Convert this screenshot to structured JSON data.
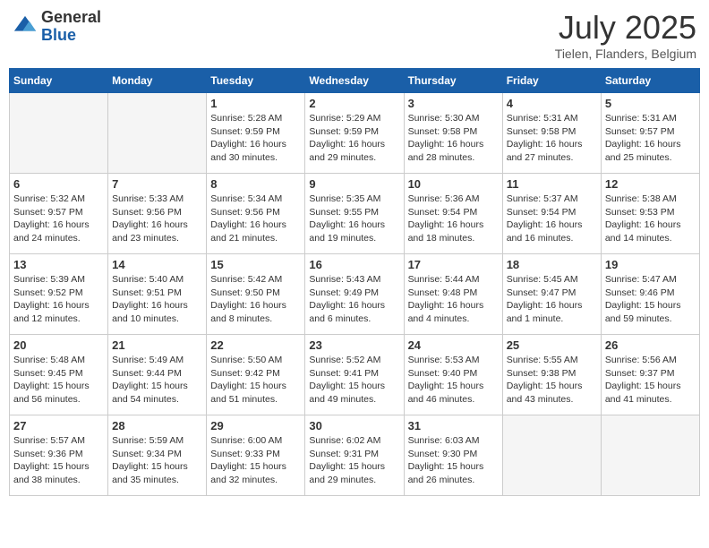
{
  "logo": {
    "general": "General",
    "blue": "Blue"
  },
  "header": {
    "month": "July 2025",
    "location": "Tielen, Flanders, Belgium"
  },
  "weekdays": [
    "Sunday",
    "Monday",
    "Tuesday",
    "Wednesday",
    "Thursday",
    "Friday",
    "Saturday"
  ],
  "weeks": [
    [
      {
        "day": "",
        "info": ""
      },
      {
        "day": "",
        "info": ""
      },
      {
        "day": "1",
        "info": "Sunrise: 5:28 AM\nSunset: 9:59 PM\nDaylight: 16 hours\nand 30 minutes."
      },
      {
        "day": "2",
        "info": "Sunrise: 5:29 AM\nSunset: 9:59 PM\nDaylight: 16 hours\nand 29 minutes."
      },
      {
        "day": "3",
        "info": "Sunrise: 5:30 AM\nSunset: 9:58 PM\nDaylight: 16 hours\nand 28 minutes."
      },
      {
        "day": "4",
        "info": "Sunrise: 5:31 AM\nSunset: 9:58 PM\nDaylight: 16 hours\nand 27 minutes."
      },
      {
        "day": "5",
        "info": "Sunrise: 5:31 AM\nSunset: 9:57 PM\nDaylight: 16 hours\nand 25 minutes."
      }
    ],
    [
      {
        "day": "6",
        "info": "Sunrise: 5:32 AM\nSunset: 9:57 PM\nDaylight: 16 hours\nand 24 minutes."
      },
      {
        "day": "7",
        "info": "Sunrise: 5:33 AM\nSunset: 9:56 PM\nDaylight: 16 hours\nand 23 minutes."
      },
      {
        "day": "8",
        "info": "Sunrise: 5:34 AM\nSunset: 9:56 PM\nDaylight: 16 hours\nand 21 minutes."
      },
      {
        "day": "9",
        "info": "Sunrise: 5:35 AM\nSunset: 9:55 PM\nDaylight: 16 hours\nand 19 minutes."
      },
      {
        "day": "10",
        "info": "Sunrise: 5:36 AM\nSunset: 9:54 PM\nDaylight: 16 hours\nand 18 minutes."
      },
      {
        "day": "11",
        "info": "Sunrise: 5:37 AM\nSunset: 9:54 PM\nDaylight: 16 hours\nand 16 minutes."
      },
      {
        "day": "12",
        "info": "Sunrise: 5:38 AM\nSunset: 9:53 PM\nDaylight: 16 hours\nand 14 minutes."
      }
    ],
    [
      {
        "day": "13",
        "info": "Sunrise: 5:39 AM\nSunset: 9:52 PM\nDaylight: 16 hours\nand 12 minutes."
      },
      {
        "day": "14",
        "info": "Sunrise: 5:40 AM\nSunset: 9:51 PM\nDaylight: 16 hours\nand 10 minutes."
      },
      {
        "day": "15",
        "info": "Sunrise: 5:42 AM\nSunset: 9:50 PM\nDaylight: 16 hours\nand 8 minutes."
      },
      {
        "day": "16",
        "info": "Sunrise: 5:43 AM\nSunset: 9:49 PM\nDaylight: 16 hours\nand 6 minutes."
      },
      {
        "day": "17",
        "info": "Sunrise: 5:44 AM\nSunset: 9:48 PM\nDaylight: 16 hours\nand 4 minutes."
      },
      {
        "day": "18",
        "info": "Sunrise: 5:45 AM\nSunset: 9:47 PM\nDaylight: 16 hours\nand 1 minute."
      },
      {
        "day": "19",
        "info": "Sunrise: 5:47 AM\nSunset: 9:46 PM\nDaylight: 15 hours\nand 59 minutes."
      }
    ],
    [
      {
        "day": "20",
        "info": "Sunrise: 5:48 AM\nSunset: 9:45 PM\nDaylight: 15 hours\nand 56 minutes."
      },
      {
        "day": "21",
        "info": "Sunrise: 5:49 AM\nSunset: 9:44 PM\nDaylight: 15 hours\nand 54 minutes."
      },
      {
        "day": "22",
        "info": "Sunrise: 5:50 AM\nSunset: 9:42 PM\nDaylight: 15 hours\nand 51 minutes."
      },
      {
        "day": "23",
        "info": "Sunrise: 5:52 AM\nSunset: 9:41 PM\nDaylight: 15 hours\nand 49 minutes."
      },
      {
        "day": "24",
        "info": "Sunrise: 5:53 AM\nSunset: 9:40 PM\nDaylight: 15 hours\nand 46 minutes."
      },
      {
        "day": "25",
        "info": "Sunrise: 5:55 AM\nSunset: 9:38 PM\nDaylight: 15 hours\nand 43 minutes."
      },
      {
        "day": "26",
        "info": "Sunrise: 5:56 AM\nSunset: 9:37 PM\nDaylight: 15 hours\nand 41 minutes."
      }
    ],
    [
      {
        "day": "27",
        "info": "Sunrise: 5:57 AM\nSunset: 9:36 PM\nDaylight: 15 hours\nand 38 minutes."
      },
      {
        "day": "28",
        "info": "Sunrise: 5:59 AM\nSunset: 9:34 PM\nDaylight: 15 hours\nand 35 minutes."
      },
      {
        "day": "29",
        "info": "Sunrise: 6:00 AM\nSunset: 9:33 PM\nDaylight: 15 hours\nand 32 minutes."
      },
      {
        "day": "30",
        "info": "Sunrise: 6:02 AM\nSunset: 9:31 PM\nDaylight: 15 hours\nand 29 minutes."
      },
      {
        "day": "31",
        "info": "Sunrise: 6:03 AM\nSunset: 9:30 PM\nDaylight: 15 hours\nand 26 minutes."
      },
      {
        "day": "",
        "info": ""
      },
      {
        "day": "",
        "info": ""
      }
    ]
  ]
}
